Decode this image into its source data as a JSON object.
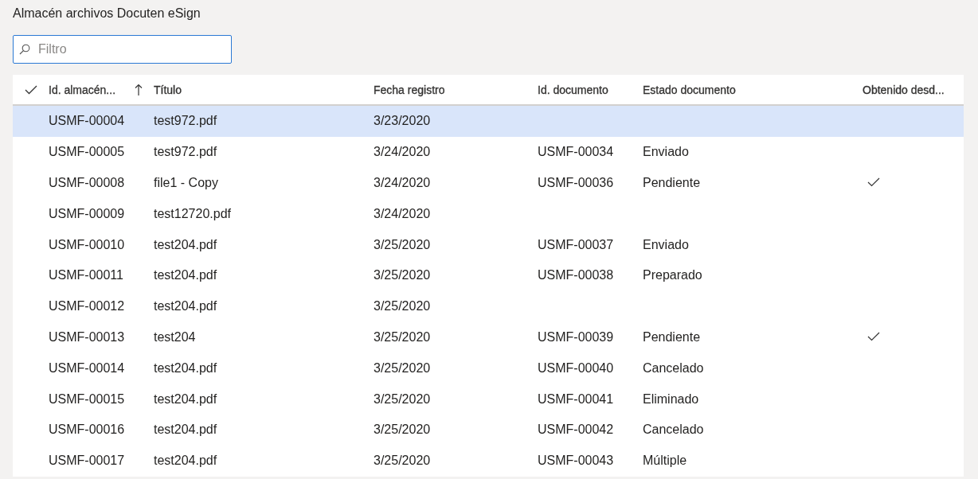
{
  "page_title": "Almacén archivos Docuten eSign",
  "filter": {
    "placeholder": "Filtro"
  },
  "table": {
    "columns": [
      {
        "label": "Id. almacén...",
        "sorted": true
      },
      {
        "label": "Título",
        "sorted": false
      },
      {
        "label": "Fecha registro",
        "sorted": false
      },
      {
        "label": "Id. documento",
        "sorted": false
      },
      {
        "label": "Estado documento",
        "sorted": false
      },
      {
        "label": "Obtenido desd...",
        "sorted": false
      }
    ],
    "rows": [
      {
        "id": "USMF-00004",
        "title": "test972.pdf",
        "date": "3/23/2020",
        "doc_id": "",
        "status": "",
        "obtained": false,
        "selected": true
      },
      {
        "id": "USMF-00005",
        "title": "test972.pdf",
        "date": "3/24/2020",
        "doc_id": "USMF-00034",
        "status": "Enviado",
        "obtained": false,
        "selected": false
      },
      {
        "id": "USMF-00008",
        "title": "file1 - Copy",
        "date": "3/24/2020",
        "doc_id": "USMF-00036",
        "status": "Pendiente",
        "obtained": true,
        "selected": false
      },
      {
        "id": "USMF-00009",
        "title": "test12720.pdf",
        "date": "3/24/2020",
        "doc_id": "",
        "status": "",
        "obtained": false,
        "selected": false
      },
      {
        "id": "USMF-00010",
        "title": "test204.pdf",
        "date": "3/25/2020",
        "doc_id": "USMF-00037",
        "status": "Enviado",
        "obtained": false,
        "selected": false
      },
      {
        "id": "USMF-00011",
        "title": "test204.pdf",
        "date": "3/25/2020",
        "doc_id": "USMF-00038",
        "status": "Preparado",
        "obtained": false,
        "selected": false
      },
      {
        "id": "USMF-00012",
        "title": "test204.pdf",
        "date": "3/25/2020",
        "doc_id": "",
        "status": "",
        "obtained": false,
        "selected": false
      },
      {
        "id": "USMF-00013",
        "title": "test204",
        "date": "3/25/2020",
        "doc_id": "USMF-00039",
        "status": "Pendiente",
        "obtained": true,
        "selected": false
      },
      {
        "id": "USMF-00014",
        "title": "test204.pdf",
        "date": "3/25/2020",
        "doc_id": "USMF-00040",
        "status": "Cancelado",
        "obtained": false,
        "selected": false
      },
      {
        "id": "USMF-00015",
        "title": "test204.pdf",
        "date": "3/25/2020",
        "doc_id": "USMF-00041",
        "status": "Eliminado",
        "obtained": false,
        "selected": false
      },
      {
        "id": "USMF-00016",
        "title": "test204.pdf",
        "date": "3/25/2020",
        "doc_id": "USMF-00042",
        "status": "Cancelado",
        "obtained": false,
        "selected": false
      },
      {
        "id": "USMF-00017",
        "title": "test204.pdf",
        "date": "3/25/2020",
        "doc_id": "USMF-00043",
        "status": "Múltiple",
        "obtained": false,
        "selected": false
      }
    ]
  }
}
